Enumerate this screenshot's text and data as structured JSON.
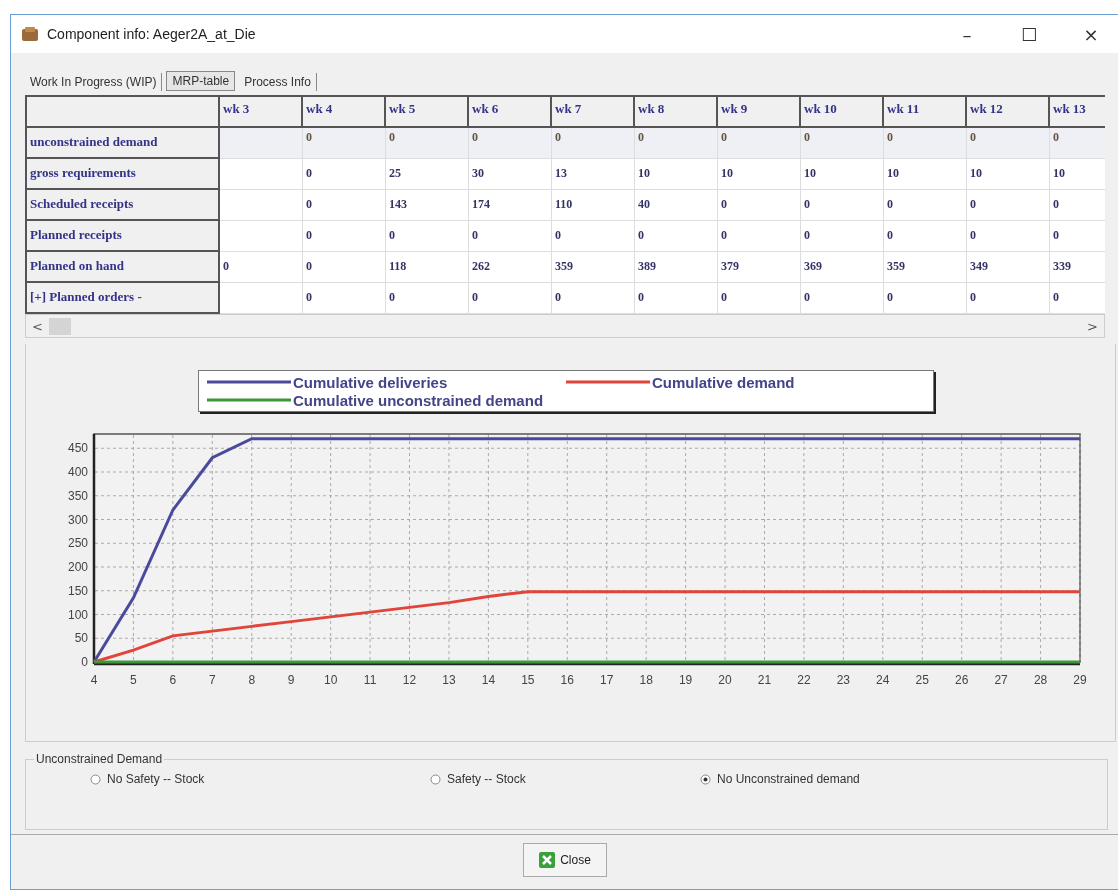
{
  "window": {
    "title": "Component info: Aeger2A_at_Die",
    "controls": [
      "–",
      "☐",
      "×"
    ]
  },
  "tabs": [
    {
      "label": "Work In Progress (WIP)",
      "selected": false
    },
    {
      "label": "MRP-table",
      "selected": true
    },
    {
      "label": "Process Info",
      "selected": false
    }
  ],
  "table": {
    "columns": [
      "wk 3",
      "wk 4",
      "wk 5",
      "wk 6",
      "wk 7",
      "wk 8",
      "wk 9",
      "wk 10",
      "wk 11",
      "wk 12",
      "wk 13"
    ],
    "rows": [
      {
        "label": "unconstrained demand",
        "kind": "shaded",
        "cells": [
          null,
          "0",
          "0",
          "0",
          "0",
          "0",
          "0",
          "0",
          "0",
          "0",
          "0"
        ]
      },
      {
        "label": "gross requirements",
        "kind": "plain",
        "cells": [
          null,
          "0",
          "25",
          "30",
          "13",
          "10",
          "10",
          "10",
          "10",
          "10",
          "10"
        ]
      },
      {
        "label": "Scheduled receipts",
        "kind": "plain",
        "cells": [
          null,
          "0",
          "143",
          "174",
          "110",
          "40",
          "0",
          "0",
          "0",
          "0",
          "0"
        ]
      },
      {
        "label": "Planned receipts",
        "kind": "plain",
        "cells": [
          null,
          "0",
          "0",
          "0",
          "0",
          "0",
          "0",
          "0",
          "0",
          "0",
          "0"
        ]
      },
      {
        "label": "Planned on hand",
        "kind": "plain",
        "cells": [
          "0",
          "0",
          "118",
          "262",
          "359",
          "389",
          "379",
          "369",
          "359",
          "349",
          "339"
        ]
      },
      {
        "label": "[+] Planned orders -",
        "kind": "plain",
        "cells": [
          null,
          "0",
          "0",
          "0",
          "0",
          "0",
          "0",
          "0",
          "0",
          "0",
          "0"
        ]
      }
    ],
    "scrollbar": {
      "left": "<",
      "right": ">"
    }
  },
  "chart": {
    "chart_data": {
      "type": "line",
      "x": [
        4,
        5,
        6,
        7,
        8,
        9,
        10,
        11,
        12,
        13,
        14,
        15,
        16,
        17,
        18,
        19,
        20,
        21,
        22,
        23,
        24,
        25,
        26,
        27,
        28,
        29
      ],
      "series": [
        {
          "name": "Cumulative deliveries",
          "color": "#4a4a9c",
          "values": [
            0,
            135,
            320,
            430,
            470,
            470,
            470,
            470,
            470,
            470,
            470,
            470,
            470,
            470,
            470,
            470,
            470,
            470,
            470,
            470,
            470,
            470,
            470,
            470,
            470,
            470
          ]
        },
        {
          "name": "Cumulative demand",
          "color": "#e0443a",
          "values": [
            0,
            25,
            55,
            65,
            75,
            85,
            95,
            105,
            115,
            125,
            138,
            148,
            148,
            148,
            148,
            148,
            148,
            148,
            148,
            148,
            148,
            148,
            148,
            148,
            148,
            148
          ]
        },
        {
          "name": "Cumulative unconstrained demand",
          "color": "#3a9a3a",
          "values": [
            0,
            0,
            0,
            0,
            0,
            0,
            0,
            0,
            0,
            0,
            0,
            0,
            0,
            0,
            0,
            0,
            0,
            0,
            0,
            0,
            0,
            0,
            0,
            0,
            0,
            0
          ]
        }
      ],
      "xlim": [
        4,
        29
      ],
      "ylim": [
        0,
        480
      ],
      "xticks": [
        4,
        5,
        6,
        7,
        8,
        9,
        10,
        11,
        12,
        13,
        14,
        15,
        16,
        17,
        18,
        19,
        20,
        21,
        22,
        23,
        24,
        25,
        26,
        27,
        28,
        29
      ],
      "yticks": [
        0,
        50,
        100,
        150,
        200,
        250,
        300,
        350,
        400,
        450
      ],
      "grid": true
    }
  },
  "unconstrained_demand": {
    "title": "Unconstrained Demand",
    "options": [
      {
        "label": "No Safety -- Stock",
        "selected": false
      },
      {
        "label": "Safety -- Stock",
        "selected": false
      },
      {
        "label": "No Unconstrained demand",
        "selected": true
      }
    ]
  },
  "buttons": [
    {
      "label": "Close"
    }
  ]
}
